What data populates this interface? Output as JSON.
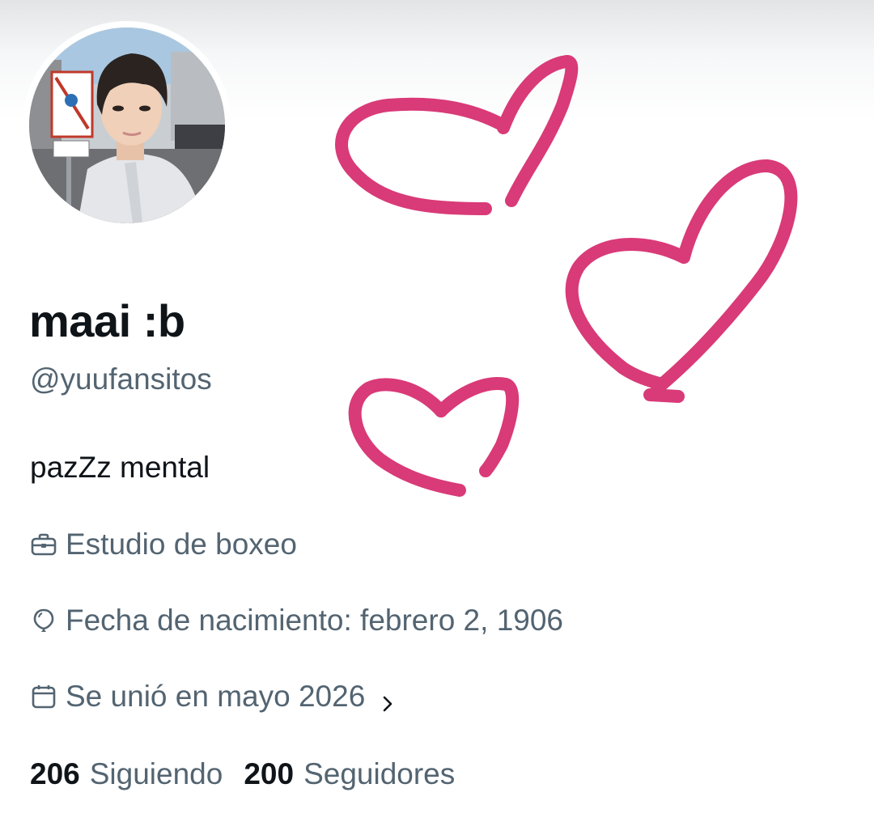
{
  "profile": {
    "display_name": "maai :b",
    "handle": "@yuufansitos",
    "bio": "pazZz mental",
    "profession": "Estudio de boxeo",
    "birth_date": "Fecha de nacimiento: febrero 2, 1906",
    "joined": "Se unió en mayo 2026"
  },
  "stats": {
    "following_count": "206",
    "following_label": "Siguiendo",
    "followers_count": "200",
    "followers_label": "Seguidores"
  },
  "icons": {
    "profession": "briefcase-icon",
    "birth": "balloon-icon",
    "joined": "calendar-icon",
    "chevron": "chevron-right-icon"
  },
  "colors": {
    "text_primary": "#0f1419",
    "text_secondary": "#536471",
    "heart_doodle": "#d93a78"
  }
}
